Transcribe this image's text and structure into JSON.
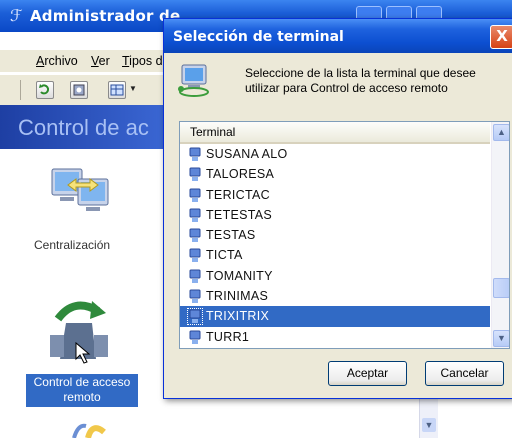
{
  "background_window": {
    "title": "Administrador de",
    "menu": [
      {
        "label": "Archivo",
        "hotkey_index": 0
      },
      {
        "label": "Ver",
        "hotkey_index": 0
      },
      {
        "label": "Tipos d",
        "hotkey_index": 0
      }
    ],
    "header_title": "Control de ac",
    "icons": [
      {
        "label": "Centralización",
        "icon": "computers-arrows-icon"
      },
      {
        "label": "Control de acceso remoto",
        "label_line1": "Control de acceso",
        "label_line2": "remoto",
        "icon": "remote-access-icon",
        "selected": true
      }
    ],
    "partial_text": "control"
  },
  "dialog": {
    "title": "Selección de terminal",
    "close_label": "X",
    "message": "Seleccione de la lista la terminal que desee utilizar para Control de acceso remoto",
    "list_header": "Terminal",
    "terminals": [
      {
        "name": "SUSANA ALO",
        "selected": false
      },
      {
        "name": "TALORESA",
        "selected": false
      },
      {
        "name": "TERICTAC",
        "selected": false
      },
      {
        "name": "TETESTAS",
        "selected": false
      },
      {
        "name": "TESTAS",
        "selected": false
      },
      {
        "name": "TICTA",
        "selected": false
      },
      {
        "name": "TOMANITY",
        "selected": false
      },
      {
        "name": "TRINIMAS",
        "selected": false
      },
      {
        "name": "TRIXITRIX",
        "selected": true
      },
      {
        "name": "TURR1",
        "selected": false
      }
    ],
    "ok_label": "Aceptar",
    "cancel_label": "Cancelar"
  },
  "colors": {
    "titlebar": "#0a48c6",
    "selection": "#316ac5",
    "dialog_bg": "#ece9d8",
    "close_button": "#d64215"
  }
}
